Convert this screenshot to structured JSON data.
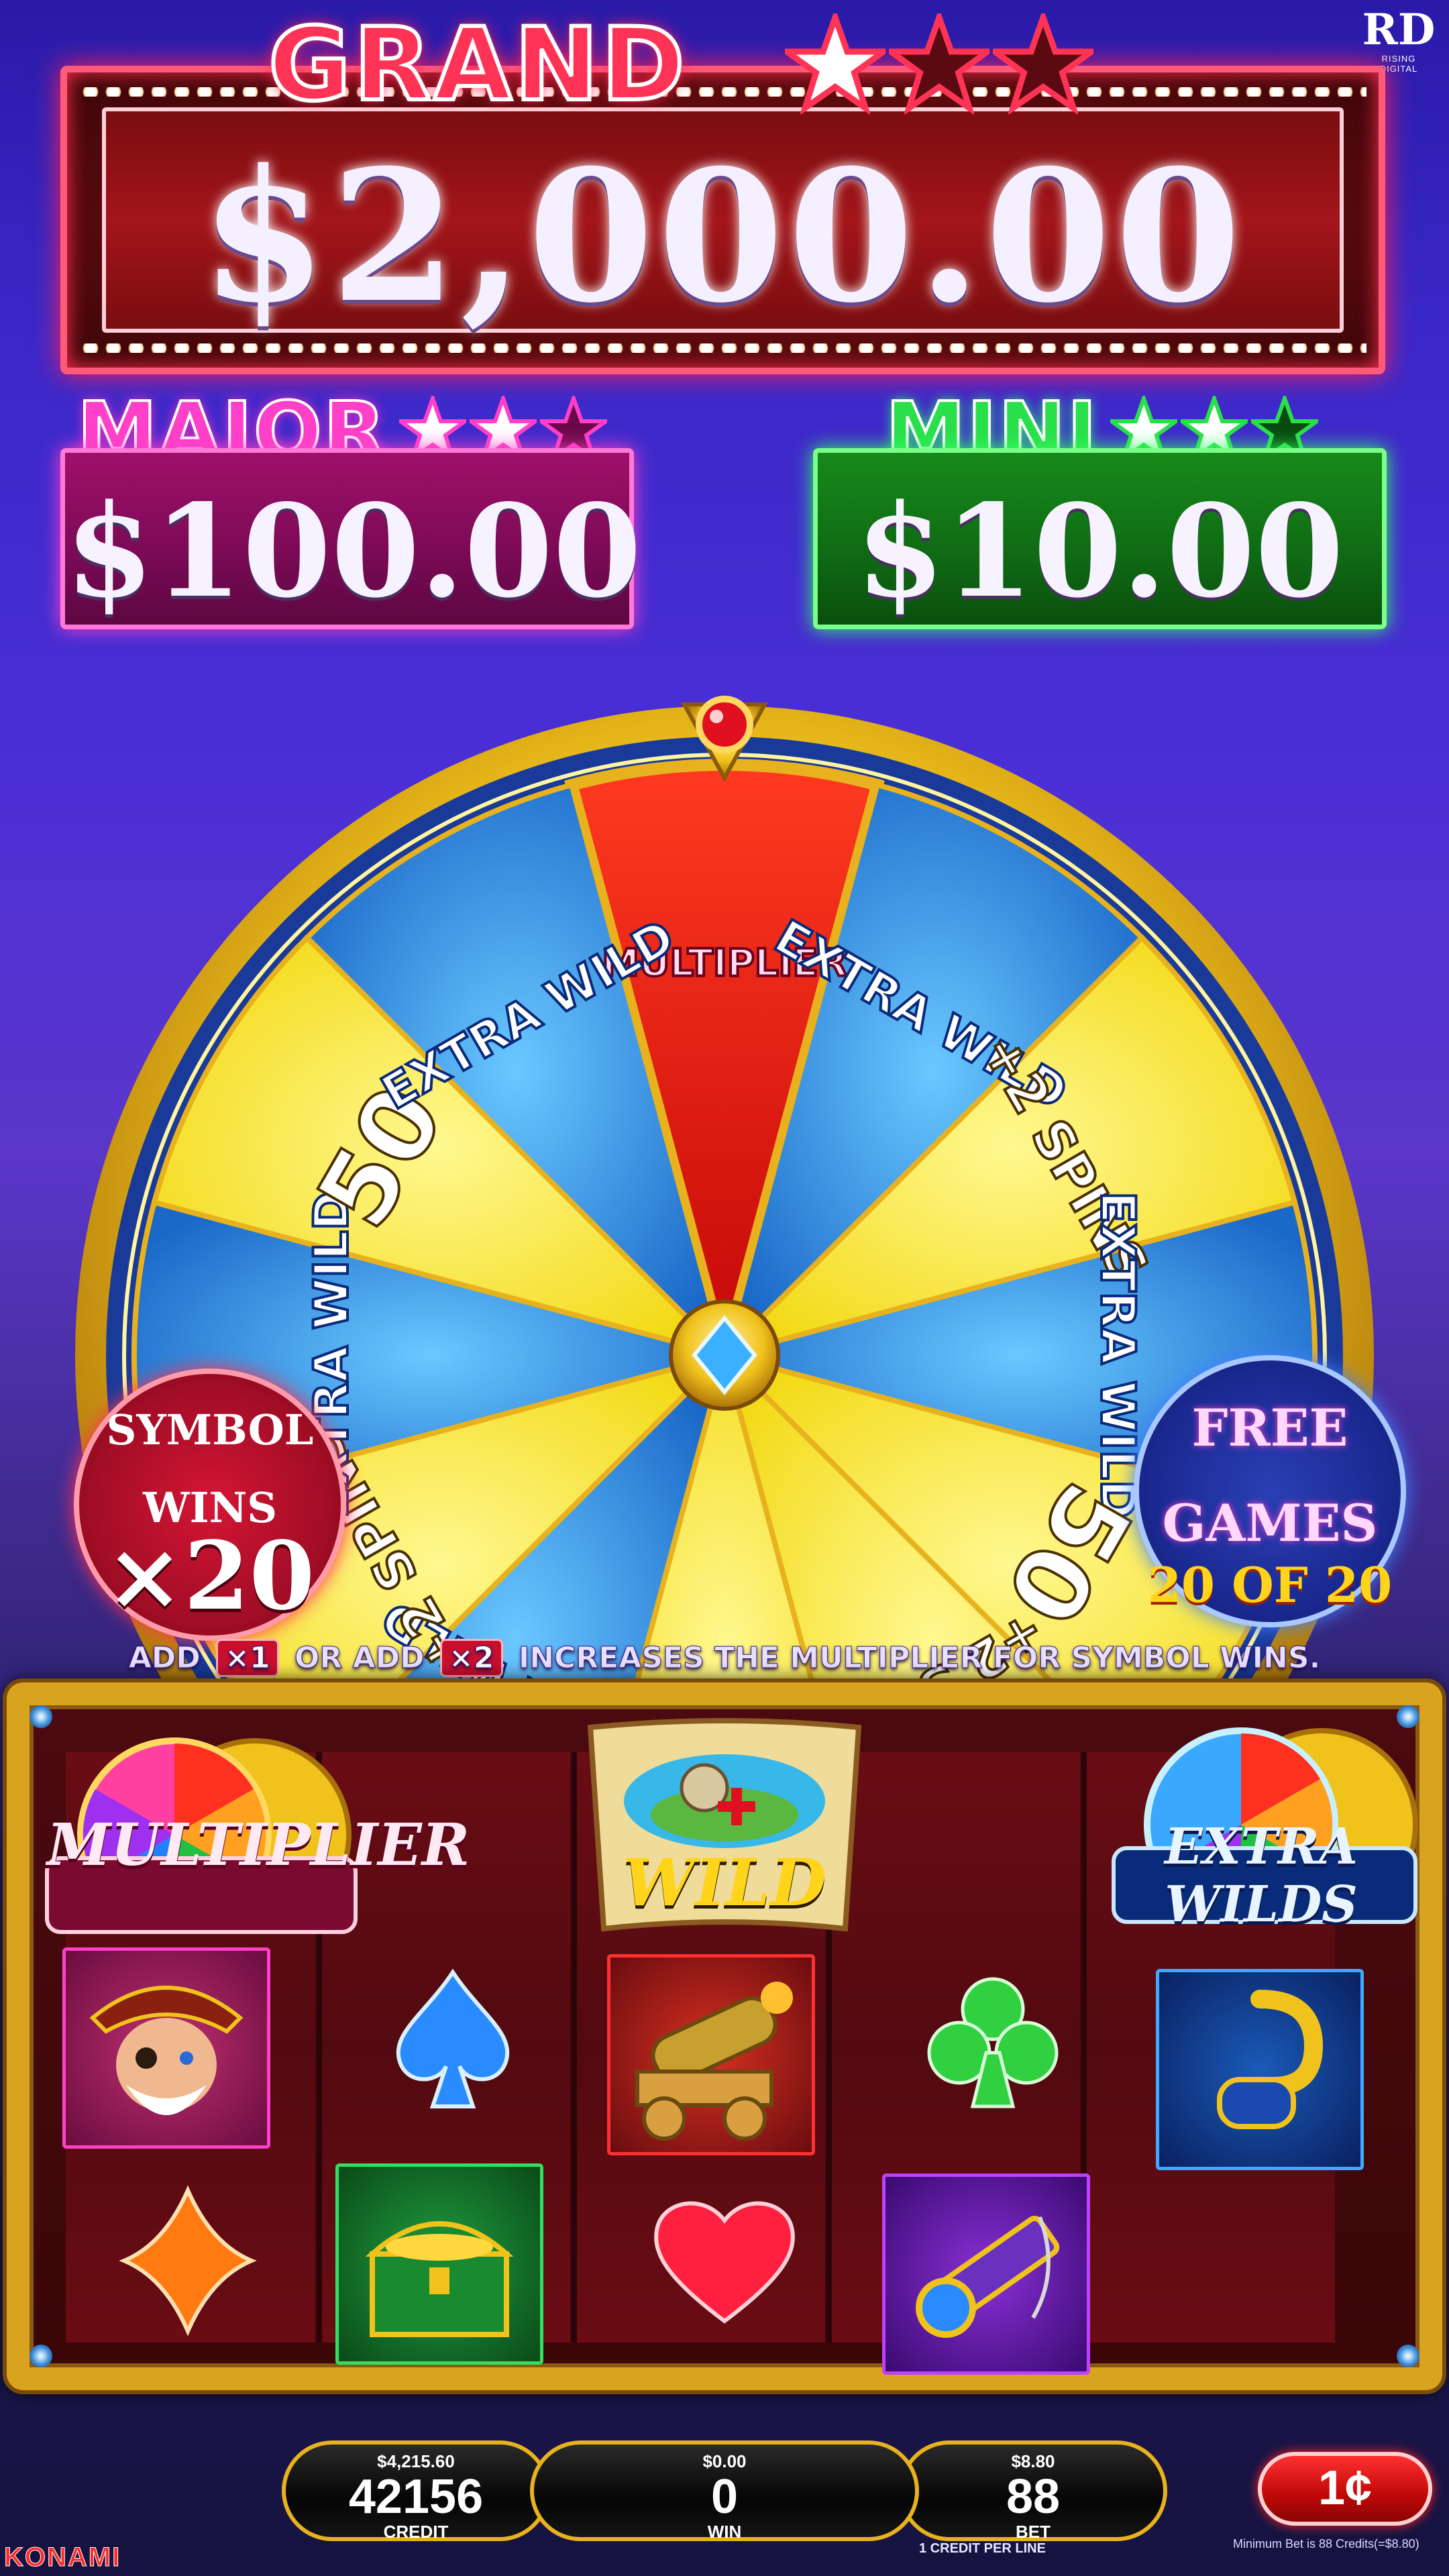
{
  "brand": {
    "studio_mark": "RD",
    "studio_name": "RISING DIGITAL",
    "maker": "KONAMI"
  },
  "jackpots": {
    "grand": {
      "title": "GRAND",
      "value": "$2,000.00",
      "stars_lit": 1,
      "stars_total": 3
    },
    "major": {
      "title": "MAJOR",
      "value": "$100.00",
      "stars_lit": 2,
      "stars_total": 3
    },
    "mini": {
      "title": "MINI",
      "value": "$10.00",
      "stars_lit": 2,
      "stars_total": 3
    }
  },
  "wheel": {
    "segments": [
      "MULTIPLIER",
      "EXTRA WILD",
      "+2 SPINS",
      "EXTRA WILD",
      "50",
      "+2 SPINS",
      "50",
      "EXTRA WILD",
      "+2 SPINS",
      "EXTRA WILD",
      "50",
      "EXTRA WILD"
    ]
  },
  "badges": {
    "symbol_wins": {
      "line1": "SYMBOL",
      "line2": "WINS",
      "value": "×20"
    },
    "free_games": {
      "line1": "FREE",
      "line2": "GAMES",
      "count": "20 OF 20"
    }
  },
  "info": {
    "add": "ADD",
    "x1": "×1",
    "or": "OR",
    "x2": "×2",
    "text": "INCREASES THE MULTIPLIER FOR SYMBOL WINS."
  },
  "reels": {
    "features": {
      "multiplier": "MULTIPLIER",
      "wild": "WILD",
      "extra_wilds": "EXTRA WILDS"
    },
    "symbols": [
      "pirate-captain",
      "blue-spade",
      "cannon",
      "green-club",
      "hook",
      "orange-diamond",
      "treasure-chest",
      "red-heart",
      "spyglass"
    ]
  },
  "meters": {
    "credit": {
      "top": "$4,215.60",
      "value": "42156",
      "label": "CREDIT"
    },
    "win": {
      "top": "$0.00",
      "value": "0",
      "label": "WIN"
    },
    "bet": {
      "top": "$8.80",
      "value": "88",
      "label": "BET",
      "sub": "1 CREDIT PER LINE"
    }
  },
  "denomination": "1¢",
  "min_bet_text": "Minimum Bet is 88 Credits(=$8.80)",
  "colors": {
    "grand": "#ff3355",
    "major": "#ff40c8",
    "mini": "#29e04a",
    "gold": "#e8b21e"
  }
}
